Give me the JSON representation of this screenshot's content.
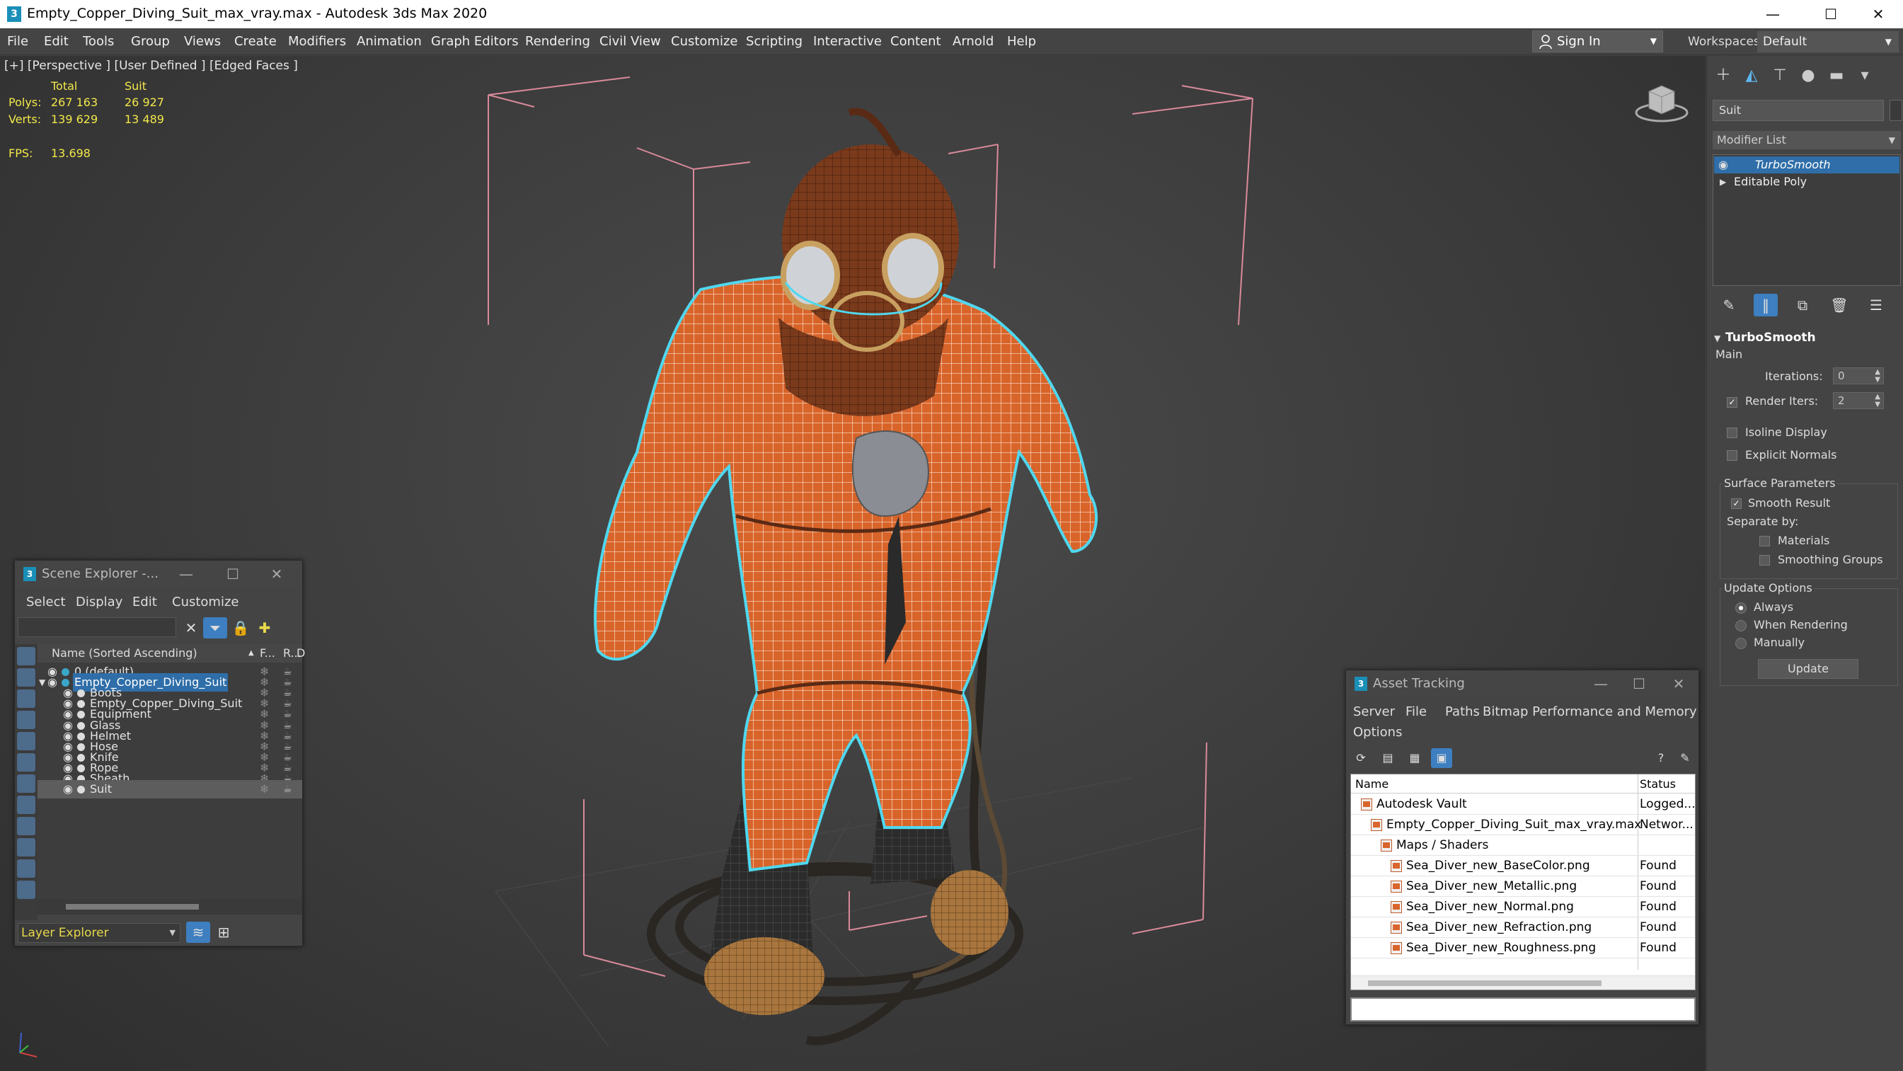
{
  "window": {
    "title": "Empty_Copper_Diving_Suit_max_vray.max - Autodesk 3ds Max 2020",
    "app_icon": "3",
    "minimize": "—",
    "maximize": "☐",
    "close": "✕"
  },
  "menubar": {
    "items": [
      "File",
      "Edit",
      "Tools",
      "Group",
      "Views",
      "Create",
      "Modifiers",
      "Animation",
      "Graph Editors",
      "Rendering",
      "Civil View",
      "Customize",
      "Scripting",
      "Interactive",
      "Content",
      "Arnold",
      "Help"
    ],
    "signin": "Sign In",
    "workspaces_label": "Workspaces:",
    "workspace_value": "Default"
  },
  "viewport": {
    "label": "[+] [Perspective ] [User Defined ] [Edged Faces ]",
    "stats": {
      "col_total": "Total",
      "col_suit": "Suit",
      "polys_label": "Polys:",
      "polys_total": "267 163",
      "polys_suit": "26 927",
      "verts_label": "Verts:",
      "verts_total": "139 629",
      "verts_suit": "13 489",
      "fps_label": "FPS:",
      "fps_value": "13.698"
    }
  },
  "command_panel": {
    "tabs": [
      "create-icon",
      "modify-icon",
      "hierarchy-icon",
      "motion-icon",
      "display-icon",
      "utilities-icon"
    ],
    "object_name": "Suit",
    "modifier_list": "Modifier List",
    "stack": [
      "TurboSmooth",
      "Editable Poly"
    ],
    "turbosmooth": {
      "title": "TurboSmooth",
      "main": "Main",
      "iterations_label": "Iterations:",
      "iterations": "0",
      "render_iters_label": "Render Iters:",
      "render_iters": "2",
      "render_iters_checked": true,
      "isoline": "Isoline Display",
      "explicit_normals": "Explicit Normals",
      "surface_params": "Surface Parameters",
      "smooth_result": "Smooth Result",
      "smooth_result_checked": true,
      "separate_by": "Separate by:",
      "materials": "Materials",
      "smoothing_groups": "Smoothing Groups",
      "update_options": "Update Options",
      "always": "Always",
      "when_rendering": "When Rendering",
      "manually": "Manually",
      "update_button": "Update"
    }
  },
  "scene_explorer": {
    "title": "Scene Explorer -...",
    "menus": [
      "Select",
      "Display",
      "Edit",
      "Customize"
    ],
    "col_name": "Name (Sorted Ascending)",
    "col_f": "F...",
    "col_r": "R...",
    "col_d": "D",
    "rows": [
      {
        "name": "0 (default)",
        "level": 0
      },
      {
        "name": "Empty_Copper_Diving_Suit",
        "level": 0,
        "selected_name": true
      },
      {
        "name": "Boots",
        "level": 1
      },
      {
        "name": "Empty_Copper_Diving_Suit",
        "level": 1
      },
      {
        "name": "Equipment",
        "level": 1
      },
      {
        "name": "Glass",
        "level": 1
      },
      {
        "name": "Helmet",
        "level": 1
      },
      {
        "name": "Hose",
        "level": 1
      },
      {
        "name": "Knife",
        "level": 1
      },
      {
        "name": "Rope",
        "level": 1
      },
      {
        "name": "Sheath",
        "level": 1
      },
      {
        "name": "Suit",
        "level": 1,
        "highlight": true
      }
    ],
    "layer_explorer": "Layer Explorer"
  },
  "asset_tracking": {
    "title": "Asset Tracking",
    "menus": [
      "Server",
      "File",
      "Paths",
      "Bitmap Performance and Memory",
      "Options"
    ],
    "col_name": "Name",
    "col_status": "Status",
    "rows": [
      {
        "name": "Autodesk Vault",
        "status": "Logged...",
        "indent": 1
      },
      {
        "name": "Empty_Copper_Diving_Suit_max_vray.max",
        "status": "Networ...",
        "indent": 2
      },
      {
        "name": "Maps / Shaders",
        "status": "",
        "indent": 3
      },
      {
        "name": "Sea_Diver_new_BaseColor.png",
        "status": "Found",
        "indent": 4
      },
      {
        "name": "Sea_Diver_new_Metallic.png",
        "status": "Found",
        "indent": 4
      },
      {
        "name": "Sea_Diver_new_Normal.png",
        "status": "Found",
        "indent": 4
      },
      {
        "name": "Sea_Diver_new_Refraction.png",
        "status": "Found",
        "indent": 4
      },
      {
        "name": "Sea_Diver_new_Roughness.png",
        "status": "Found",
        "indent": 4
      }
    ]
  },
  "colors": {
    "stat_yellow": "#f2e84a",
    "selection_blue": "#2f6ea8",
    "suit_orange": "#d8642a",
    "selection_outline": "#4fd8f0",
    "bbox_pink": "#d98a9a"
  }
}
